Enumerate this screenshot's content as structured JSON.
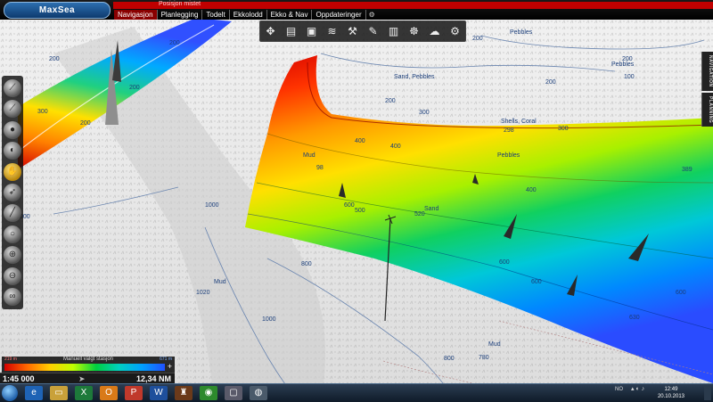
{
  "app": {
    "logo": "MaxSea",
    "alert": "Posisjon mistet"
  },
  "menu": {
    "items": [
      "Navigasjon",
      "Planlegging",
      "Todelt",
      "Ekkolodd",
      "Ekko & Nav",
      "Oppdateringer"
    ],
    "active": "Navigasjon",
    "gear": "⚙"
  },
  "side_tabs": [
    "NAVIGATION",
    "PLANNING"
  ],
  "toolbar_icons": [
    "compass-icon",
    "chart-3d-icon",
    "display-icon",
    "layers-icon",
    "tools-icon",
    "pencil-icon",
    "book-icon",
    "sailor-icon",
    "weather-icon",
    "settings-icon"
  ],
  "left_tools": [
    "ruler-icon",
    "brush-icon",
    "sphere-icon",
    "sphere-flat-icon",
    "hand-icon",
    "compass-arrow-icon",
    "line-icon",
    "circle-icon",
    "zoom-icon",
    "zoom-out-icon",
    "binoculars-icon"
  ],
  "depth_legend": {
    "title": "Manuell valgt stasjon",
    "min": "219 m",
    "max": "671 m",
    "plus": "+"
  },
  "scale": {
    "ratio": "1:45 000",
    "arrow": "➤",
    "distance": "12,34 NM"
  },
  "map_labels": {
    "depths": [
      "100",
      "200",
      "200",
      "200",
      "200",
      "200",
      "200",
      "200",
      "200",
      "300",
      "300",
      "300",
      "389",
      "400",
      "400",
      "400",
      "500",
      "520",
      "600",
      "600",
      "600",
      "600",
      "630",
      "780",
      "800",
      "800",
      "900",
      "1000",
      "1000",
      "1020"
    ],
    "seabed": [
      "Pebbles",
      "Pebbles",
      "Sand, Pebbles",
      "Shells, Coral",
      "Pebbles",
      "Sand",
      "Mud",
      "Mud",
      "Mud"
    ],
    "marks": [
      "298",
      "98"
    ]
  },
  "taskbar": {
    "apps": [
      "ie-icon",
      "folder-icon",
      "excel-icon",
      "outlook-icon",
      "powerpoint-icon",
      "word-icon",
      "game-icon",
      "chrome-icon",
      "window-icon",
      "camera-icon"
    ],
    "lang": "NO",
    "time": "12:49",
    "date": "20.10.2013"
  },
  "colors": {
    "red": "#c00000",
    "accent": "#8a0000",
    "taskbar": "#0f1b29"
  }
}
